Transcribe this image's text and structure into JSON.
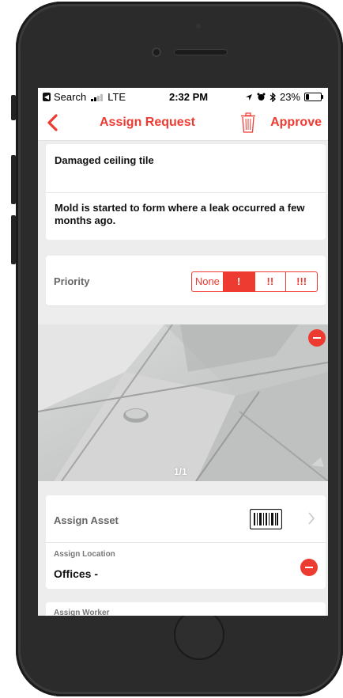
{
  "status_bar": {
    "back_app": "Search",
    "carrier": "LTE",
    "time": "2:32 PM",
    "battery": "23%",
    "battery_level": 0.23,
    "icons": [
      "back-badge-icon",
      "signal-icon",
      "location-arrow-icon",
      "alarm-icon",
      "bluetooth-icon",
      "battery-icon"
    ]
  },
  "nav": {
    "title": "Assign Request",
    "approve_label": "Approve",
    "back_icon": "chevron-left-icon",
    "trash_icon": "trash-icon"
  },
  "request": {
    "title": "Damaged ceiling tile",
    "description": "Mold is started to form where a leak occurred a few months ago."
  },
  "priority": {
    "label": "Priority",
    "options": [
      "None",
      "!",
      "!!",
      "!!!"
    ],
    "selected": "!"
  },
  "photo": {
    "counter": "1/1",
    "remove_icon": "minus-circle-icon"
  },
  "assign": {
    "asset_label": "Assign Asset",
    "asset_icons": [
      "barcode-icon",
      "chevron-right-icon"
    ],
    "location_label": "Assign Location",
    "location_value": "Offices -",
    "worker_label": "Assign Worker"
  },
  "colors": {
    "accent": "#ee3b32",
    "background": "#ededed",
    "phone_body": "#2b2b2b"
  }
}
